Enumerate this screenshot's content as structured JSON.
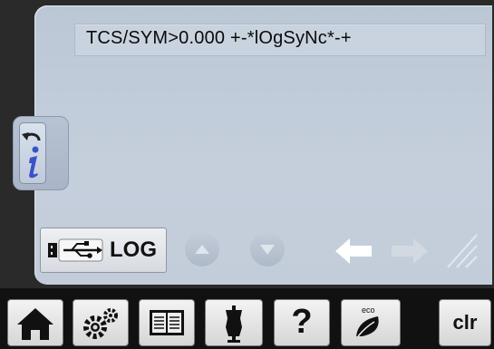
{
  "command_line": {
    "text": "TCS/SYM>0.000 +-*lOgSyNc*-+"
  },
  "log_button": {
    "label": "LOG",
    "icon": "usb-icon"
  },
  "toolbar": {
    "clr_label": "clr",
    "help_label": "?",
    "eco_label": "eco",
    "icons": [
      "home-icon",
      "settings-icon",
      "manual-book-icon",
      "dress-form-icon",
      "help-icon",
      "eco-leaf-icon",
      "clear-icon"
    ]
  },
  "colors": {
    "panel_bg": "#c5cfdc",
    "bar_bg": "#111111",
    "accent_blue": "#3a52c8",
    "arrow_active": "#ffffff",
    "arrow_inactive": "#d3d9e2"
  }
}
